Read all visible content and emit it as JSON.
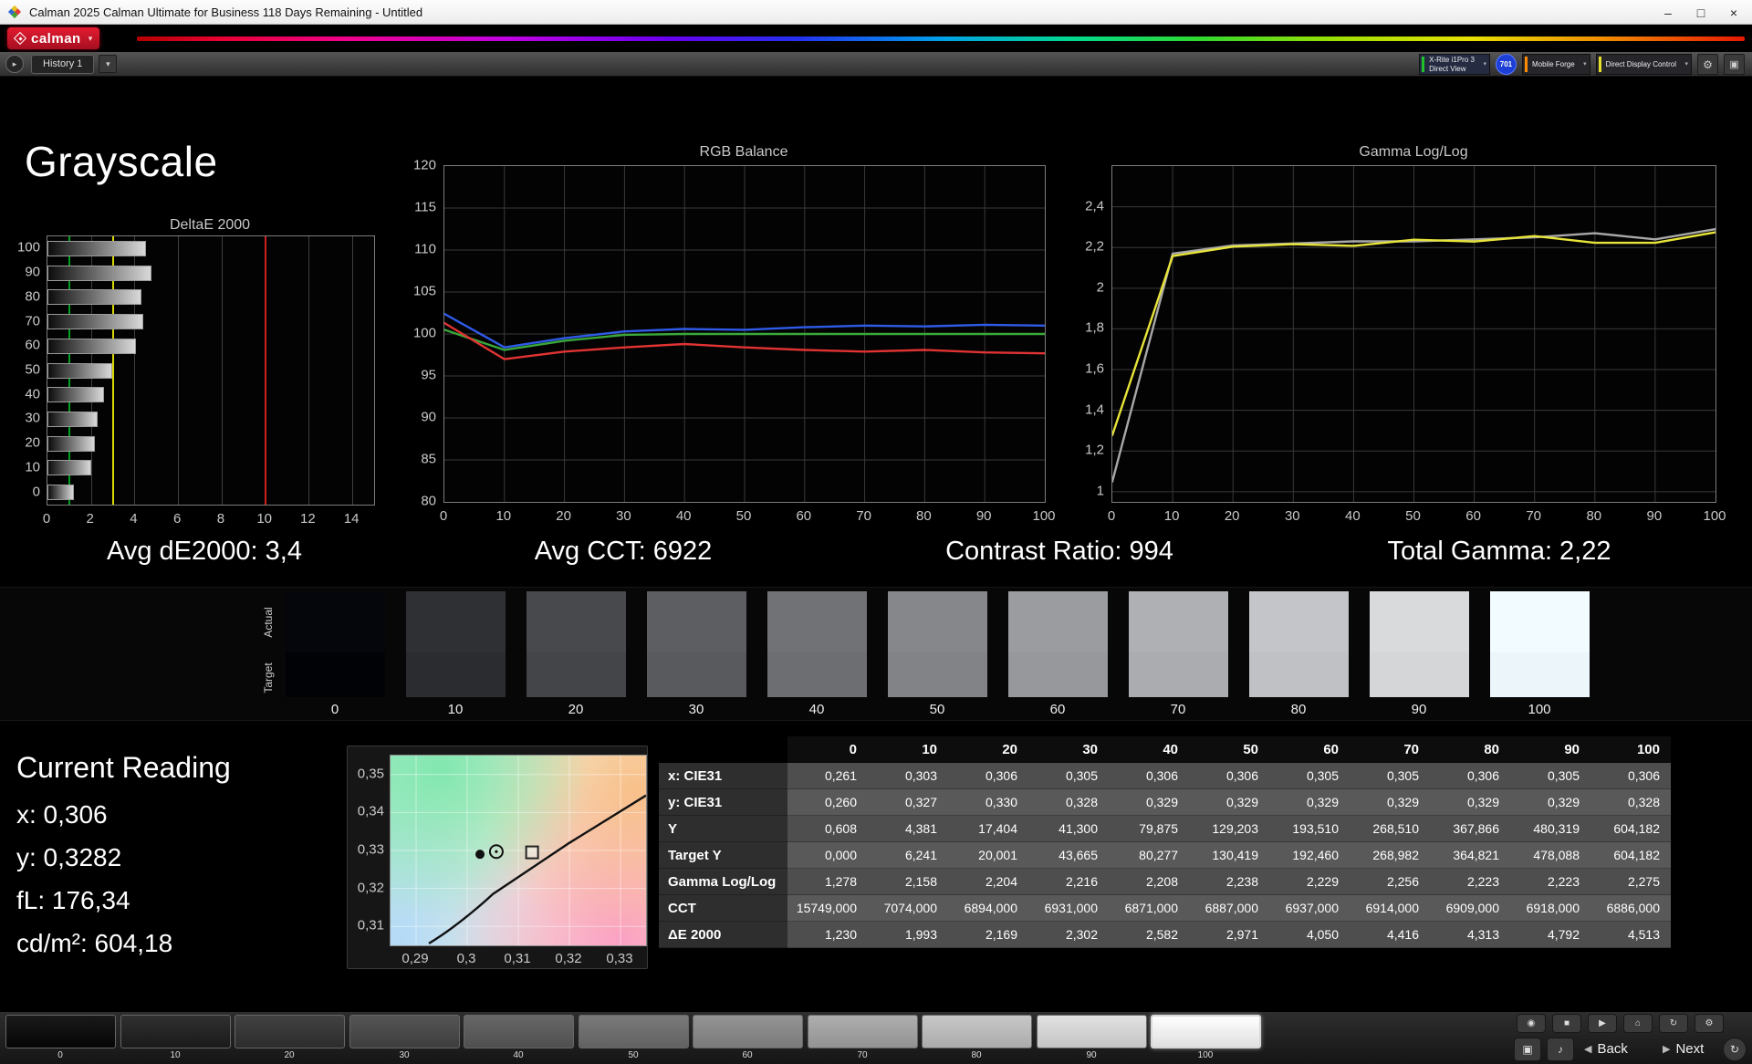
{
  "window": {
    "title": "Calman 2025 Calman Ultimate for Business 118 Days Remaining  - Untitled",
    "minimize_glyph": "–",
    "maximize_glyph": "□",
    "close_glyph": "×"
  },
  "brand": {
    "logo_text": "calman",
    "dropdown_arrow": "▾"
  },
  "icons": {
    "caret_down": "▾",
    "expand": "▸",
    "swap": "◂▸",
    "play": "▶",
    "stop": "■",
    "record": "◉",
    "home": "⌂",
    "refresh": "↻",
    "gear": "⚙",
    "panel": "▣",
    "note": "♪",
    "back": "◀",
    "next": "▶"
  },
  "toolbar": {
    "history_tab": "History 1",
    "meters": [
      {
        "label_line1": "X-Rite i1Pro 3",
        "label_line2": "Direct View",
        "accent": "#22c32a",
        "highlight": true
      },
      {
        "type": "badge",
        "label": "701",
        "color": "#1d3fd6"
      },
      {
        "label": "Mobile Forge",
        "accent": "#ff8c00"
      },
      {
        "label": "Direct Display Control",
        "accent": "#e8e12c"
      }
    ]
  },
  "page": {
    "title": "Grayscale"
  },
  "metrics": [
    "Avg dE2000: 3,4",
    "Avg CCT: 6922",
    "Contrast Ratio: 994",
    "Total Gamma: 2,22"
  ],
  "chart_data": [
    {
      "id": "deltae-2000",
      "type": "bar",
      "orientation": "horizontal",
      "title": "DeltaE 2000",
      "categories": [
        100,
        90,
        80,
        70,
        60,
        50,
        40,
        30,
        20,
        10,
        0
      ],
      "values": [
        4.513,
        4.792,
        4.313,
        4.416,
        4.05,
        2.971,
        2.582,
        2.302,
        2.169,
        1.993,
        1.23
      ],
      "xlim": [
        0,
        15
      ],
      "xticks": [
        0,
        2,
        4,
        6,
        8,
        10,
        12,
        14
      ],
      "reference_lines": [
        {
          "x": 1,
          "color": "#00a020"
        },
        {
          "x": 3,
          "color": "#d8d800"
        },
        {
          "x": 10,
          "color": "#d02020"
        }
      ]
    },
    {
      "id": "rgb-balance",
      "type": "line",
      "title": "RGB Balance",
      "x": [
        0,
        10,
        20,
        30,
        40,
        50,
        60,
        70,
        80,
        90,
        100
      ],
      "xticks": [
        0,
        10,
        20,
        30,
        40,
        50,
        60,
        70,
        80,
        90,
        100
      ],
      "ylim": [
        80,
        120
      ],
      "yticks": [
        80,
        85,
        90,
        95,
        100,
        105,
        110,
        115,
        120
      ],
      "series": [
        {
          "name": "Green",
          "color": "#3aa83a",
          "values": [
            100.5,
            98.1,
            99.2,
            99.9,
            100.0,
            100.0,
            100.0,
            100.0,
            100.0,
            100.0,
            100.0
          ]
        },
        {
          "name": "Red",
          "color": "#e23333",
          "values": [
            101.3,
            97.0,
            97.9,
            98.4,
            98.8,
            98.4,
            98.1,
            97.9,
            98.1,
            97.8,
            97.7
          ]
        },
        {
          "name": "Blue",
          "color": "#2f5be8",
          "values": [
            102.4,
            98.4,
            99.5,
            100.3,
            100.6,
            100.5,
            100.8,
            101.0,
            100.9,
            101.1,
            101.0
          ]
        }
      ]
    },
    {
      "id": "gamma-log-log",
      "type": "line",
      "title": "Gamma Log/Log",
      "x": [
        0,
        10,
        20,
        30,
        40,
        50,
        60,
        70,
        80,
        90,
        100
      ],
      "xticks": [
        0,
        10,
        20,
        30,
        40,
        50,
        60,
        70,
        80,
        90,
        100
      ],
      "ylim": [
        0.95,
        2.6
      ],
      "yticks": [
        1,
        1.2,
        1.4,
        1.6,
        1.8,
        2,
        2.2,
        2.4
      ],
      "ytick_labels": [
        "1",
        "1,2",
        "1,4",
        "1,6",
        "1,8",
        "2",
        "2,2",
        "2,4"
      ],
      "series": [
        {
          "name": "Reference",
          "color": "#a8a8a8",
          "values": [
            1.05,
            2.17,
            2.21,
            2.22,
            2.23,
            2.23,
            2.24,
            2.25,
            2.27,
            2.24,
            2.29
          ]
        },
        {
          "name": "Measured Gamma",
          "color": "#e8e43a",
          "values": [
            1.278,
            2.158,
            2.204,
            2.216,
            2.208,
            2.238,
            2.229,
            2.256,
            2.223,
            2.223,
            2.275
          ]
        }
      ]
    },
    {
      "id": "cie-chromaticity",
      "type": "scatter",
      "title": "",
      "xlim": [
        0.285,
        0.335
      ],
      "ylim": [
        0.305,
        0.355
      ],
      "xticks": [
        0.29,
        0.3,
        0.31,
        0.32,
        0.33
      ],
      "xtick_labels": [
        "0,29",
        "0,3",
        "0,31",
        "0,32",
        "0,33"
      ],
      "yticks": [
        0.31,
        0.32,
        0.33,
        0.34,
        0.35
      ],
      "ytick_labels": [
        "0,31",
        "0,32",
        "0,33",
        "0,34",
        "0,35"
      ],
      "locus": [
        [
          0.2925,
          0.3055
        ],
        [
          0.305,
          0.3185
        ],
        [
          0.32,
          0.332
        ],
        [
          0.335,
          0.3445
        ]
      ],
      "markers": [
        {
          "name": "measured-point",
          "shape": "dot",
          "x": 0.3025,
          "y": 0.329
        },
        {
          "name": "current-reading-marker",
          "shape": "circle",
          "x": 0.3057,
          "y": 0.3297
        },
        {
          "name": "target-point",
          "shape": "square",
          "x": 0.3127,
          "y": 0.3295
        }
      ]
    }
  ],
  "swatch_strip": {
    "row_labels": [
      "Actual",
      "Target"
    ],
    "levels": [
      "0",
      "10",
      "20",
      "30",
      "40",
      "50",
      "60",
      "70",
      "80",
      "90",
      "100"
    ],
    "actual_colors": [
      "#05060c",
      "#2e3034",
      "#47494d",
      "#5c5e62",
      "#707276",
      "#85878b",
      "#9a9ca0",
      "#aeb0b4",
      "#c3c5c8",
      "#d8dadc",
      "#f2fbff"
    ],
    "target_colors": [
      "#010206",
      "#2a2c30",
      "#434549",
      "#585a5e",
      "#6c6e72",
      "#818387",
      "#96989c",
      "#aaacb0",
      "#bfc1c4",
      "#d4d6d8",
      "#ecf6fa"
    ]
  },
  "current_reading": {
    "title": "Current Reading",
    "lines": [
      "x: 0,306",
      "y: 0,3282",
      "fL: 176,34",
      "cd/m²: 604,18"
    ]
  },
  "table": {
    "columns": [
      "",
      "0",
      "10",
      "20",
      "30",
      "40",
      "50",
      "60",
      "70",
      "80",
      "90",
      "100"
    ],
    "rows": [
      {
        "label": "x: CIE31",
        "values": [
          "0,261",
          "0,303",
          "0,306",
          "0,305",
          "0,306",
          "0,306",
          "0,305",
          "0,305",
          "0,306",
          "0,305",
          "0,306"
        ]
      },
      {
        "label": "y: CIE31",
        "values": [
          "0,260",
          "0,327",
          "0,330",
          "0,328",
          "0,329",
          "0,329",
          "0,329",
          "0,329",
          "0,329",
          "0,329",
          "0,328"
        ]
      },
      {
        "label": "Y",
        "values": [
          "0,608",
          "4,381",
          "17,404",
          "41,300",
          "79,875",
          "129,203",
          "193,510",
          "268,510",
          "367,866",
          "480,319",
          "604,182"
        ]
      },
      {
        "label": "Target Y",
        "values": [
          "0,000",
          "6,241",
          "20,001",
          "43,665",
          "80,277",
          "130,419",
          "192,460",
          "268,982",
          "364,821",
          "478,088",
          "604,182"
        ]
      },
      {
        "label": "Gamma Log/Log",
        "values": [
          "1,278",
          "2,158",
          "2,204",
          "2,216",
          "2,208",
          "2,238",
          "2,229",
          "2,256",
          "2,223",
          "2,223",
          "2,275"
        ]
      },
      {
        "label": "CCT",
        "values": [
          "15749,000",
          "7074,000",
          "6894,000",
          "6931,000",
          "6871,000",
          "6887,000",
          "6937,000",
          "6914,000",
          "6909,000",
          "6918,000",
          "6886,000"
        ]
      },
      {
        "label": "ΔE 2000",
        "values": [
          "1,230",
          "1,993",
          "2,169",
          "2,302",
          "2,582",
          "2,971",
          "4,050",
          "4,416",
          "4,313",
          "4,792",
          "4,513"
        ]
      }
    ]
  },
  "bottom_bar": {
    "pattern_levels": [
      "0",
      "10",
      "20",
      "30",
      "40",
      "50",
      "60",
      "70",
      "80",
      "90",
      "100"
    ],
    "pattern_colors": [
      "#060606",
      "#1e1e1e",
      "#323232",
      "#464646",
      "#5a5a5a",
      "#6f6f6f",
      "#8b8b8b",
      "#a7a7a7",
      "#c3c3c3",
      "#dfdfdf",
      "#ffffff"
    ],
    "selected_level": "100",
    "back_label": "Back",
    "next_label": "Next"
  }
}
